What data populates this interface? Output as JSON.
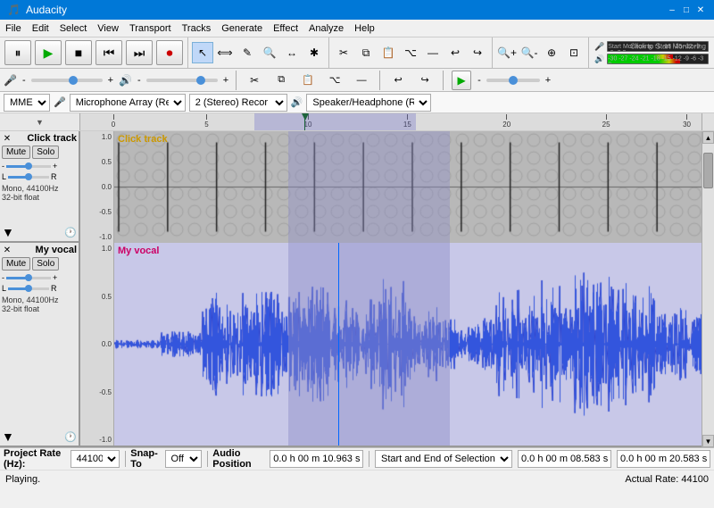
{
  "titleBar": {
    "title": "Audacity",
    "minBtn": "–",
    "maxBtn": "□",
    "closeBtn": "✕"
  },
  "menuBar": {
    "items": [
      "File",
      "Edit",
      "Select",
      "View",
      "Transport",
      "Tracks",
      "Generate",
      "Effect",
      "Analyze",
      "Help"
    ]
  },
  "toolbar": {
    "pauseLabel": "⏸",
    "playLabel": "▶",
    "stopLabel": "■",
    "skipStartLabel": "⏮",
    "skipEndLabel": "⏭",
    "recordLabel": "⏺"
  },
  "tools": {
    "items": [
      "↖",
      "✋",
      "✎",
      "⟺",
      "★",
      "✱"
    ]
  },
  "devices": {
    "host": "MME",
    "micIcon": "🎤",
    "micDevice": "Microphone Array (Realtek",
    "channels": "2 (Stereo) Recor",
    "speakerIcon": "🔊",
    "speakerDevice": "Speaker/Headphone (Realte"
  },
  "tracks": [
    {
      "name": "Click track",
      "labelColor": "#cc9900",
      "type": "click",
      "mute": "Mute",
      "solo": "Solo",
      "info": "Mono, 44100Hz\n32-bit float",
      "yAxisLabels": [
        "1.0",
        "0.5",
        "0.0",
        "-0.5",
        "-1.0"
      ],
      "height": 120
    },
    {
      "name": "My vocal",
      "labelColor": "#cc0066",
      "type": "vocal",
      "mute": "Mute",
      "solo": "Solo",
      "info": "Mono, 44100Hz\n32-bit float",
      "yAxisLabels": [
        "1.0",
        "0.5",
        "0.0",
        "-0.5",
        "-1.0"
      ],
      "height": 160
    }
  ],
  "ruler": {
    "marks": [
      {
        "pos": 0,
        "label": "0"
      },
      {
        "pos": 1,
        "label": "5"
      },
      {
        "pos": 2,
        "label": "10"
      },
      {
        "pos": 3,
        "label": "15"
      },
      {
        "pos": 4,
        "label": "20"
      },
      {
        "pos": 5,
        "label": "25"
      },
      {
        "pos": 6,
        "label": "30"
      }
    ]
  },
  "statusBar": {
    "projectRateLabel": "Project Rate (Hz):",
    "projectRate": "44100",
    "snapToLabel": "Snap-To",
    "snapTo": "Off",
    "audioPosLabel": "Audio Position",
    "audioPos": "0.0 h 00 m 10.963 s",
    "selectionLabel": "Start and End of Selection",
    "selStart": "0.0 h 00 m 08.583 s",
    "selEnd": "0.0 h 00 m 20.583 s",
    "actualRate": "Actual Rate: 44100",
    "status": "Playing."
  }
}
